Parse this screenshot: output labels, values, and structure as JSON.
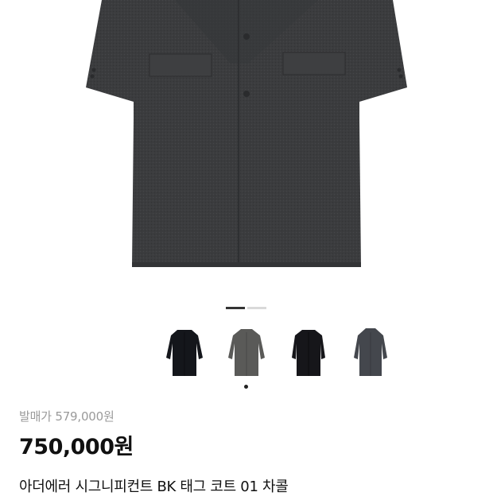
{
  "product": {
    "original_price_label": "발매가 579,000원",
    "price": "750,000원",
    "title": "아더에러 시그니피컨트 BK 태그 코트 01 차콜"
  },
  "gallery": {
    "slide_count": 2,
    "active_slide": 1,
    "main_image": "charcoal-coat-image",
    "thumbnails": [
      {
        "name": "black-coat-thumbnail",
        "color": "#14161b"
      },
      {
        "name": "grey-coat-thumbnail",
        "color": "#5a5a58"
      },
      {
        "name": "black-coat-thumbnail",
        "color": "#16161a"
      },
      {
        "name": "charcoal-coat-thumbnail",
        "color": "#44474d"
      }
    ],
    "selected_thumbnail": 2
  },
  "colors": {
    "coat_main": "#3b3c3e",
    "indicator_active": "#333333",
    "indicator_inactive": "#d9d9d9",
    "muted_text": "#9a9a9a"
  }
}
